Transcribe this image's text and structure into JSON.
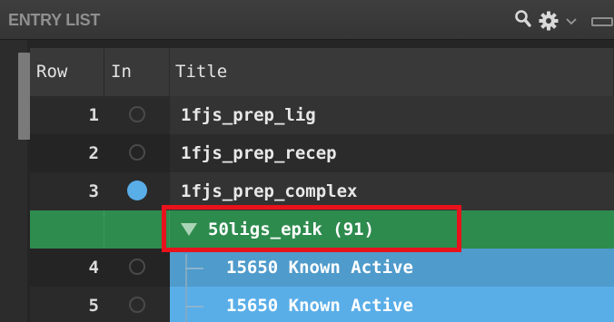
{
  "panel": {
    "title": "ENTRY LIST",
    "icons": [
      "search-icon",
      "gear-icon",
      "chevron-down-icon",
      "minimize-icon"
    ]
  },
  "columns": {
    "row": "Row",
    "in": "In",
    "title": "Title"
  },
  "rows": [
    {
      "row": "1",
      "included": false,
      "title": "1fjs_prep_lig"
    },
    {
      "row": "2",
      "included": false,
      "title": "1fjs_prep_recep"
    },
    {
      "row": "3",
      "included": true,
      "title": "1fjs_prep_complex"
    }
  ],
  "group": {
    "title": "50ligs_epik (91)",
    "expanded": true
  },
  "group_rows": [
    {
      "row": "4",
      "included": false,
      "title": "15650 Known Active"
    },
    {
      "row": "5",
      "included": false,
      "title": "15650 Known Active"
    }
  ],
  "colors": {
    "selection_blue": "#5aaee8",
    "group_green": "#2e8b4e",
    "highlight_red": "#e8121c"
  }
}
